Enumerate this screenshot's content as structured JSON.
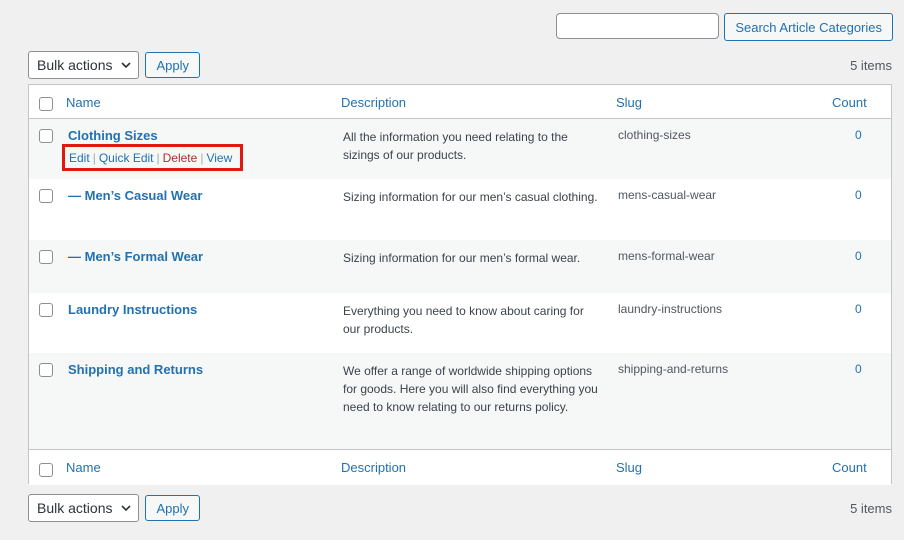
{
  "search": {
    "value": "",
    "button_label": "Search Article Categories"
  },
  "tablenav_top": {
    "bulk_label": "Bulk actions",
    "apply_label": "Apply",
    "count": "5 items"
  },
  "tablenav_bottom": {
    "bulk_label": "Bulk actions",
    "apply_label": "Apply",
    "count": "5 items"
  },
  "columns": {
    "name": "Name",
    "description": "Description",
    "slug": "Slug",
    "count": "Count"
  },
  "row_actions": {
    "edit": "Edit",
    "quick_edit": "Quick Edit",
    "delete": "Delete",
    "view": "View",
    "separator": "|"
  },
  "rows": [
    {
      "name": "Clothing Sizes",
      "description": "All the information you need relating to the sizings of our products.",
      "slug": "clothing-sizes",
      "count": "0"
    },
    {
      "name": "— Men’s Casual Wear",
      "description": "Sizing information for our men’s casual clothing.",
      "slug": "mens-casual-wear",
      "count": "0"
    },
    {
      "name": "— Men’s Formal Wear",
      "description": "Sizing information for our men’s formal wear.",
      "slug": "mens-formal-wear",
      "count": "0"
    },
    {
      "name": "Laundry Instructions",
      "description": "Everything you need to know about caring for our products.",
      "slug": "laundry-instructions",
      "count": "0"
    },
    {
      "name": "Shipping and Returns",
      "description": "We offer a range of worldwide shipping options for goods. Here you will also find everything you need to know relating to our returns policy.",
      "slug": "shipping-and-returns",
      "count": "0"
    }
  ],
  "colors": {
    "link": "#2271b1",
    "delete": "#b32d2e",
    "highlight_box": "#e0180f",
    "page_bg": "#f0f0f1"
  }
}
